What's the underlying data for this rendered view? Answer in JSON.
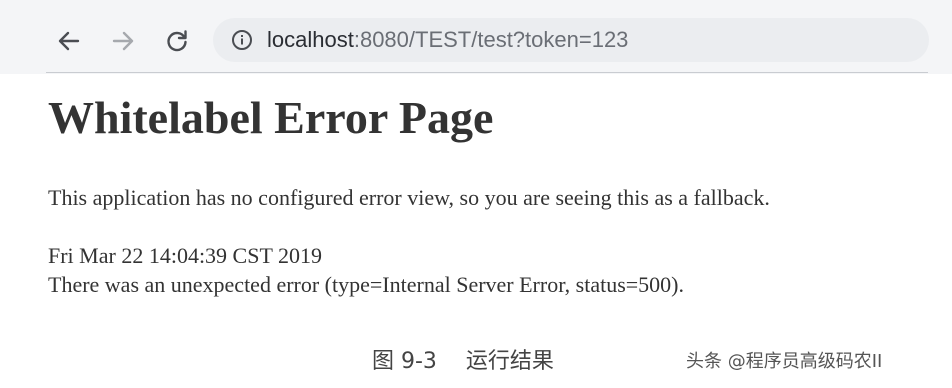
{
  "browser": {
    "back_icon": "arrow-left-icon",
    "forward_icon": "arrow-right-icon",
    "reload_icon": "reload-icon",
    "site_info_icon": "info-icon",
    "url_host": "localhost",
    "url_rest": ":8080/TEST/test?token=123"
  },
  "error_page": {
    "title": "Whitelabel Error Page",
    "message": "This application has no configured error view, so you are seeing this as a fallback.",
    "timestamp": "Fri Mar 22 14:04:39 CST 2019",
    "error_detail": "There was an unexpected error (type=Internal Server Error, status=500)."
  },
  "figure": {
    "caption": "图 9-3　 运行结果"
  },
  "watermark": {
    "text": "头条 @程序员高级码农II"
  },
  "colors": {
    "toolbar_bg": "#f4f5f7",
    "omnibox_bg": "#ebedf0",
    "text": "#333333"
  }
}
